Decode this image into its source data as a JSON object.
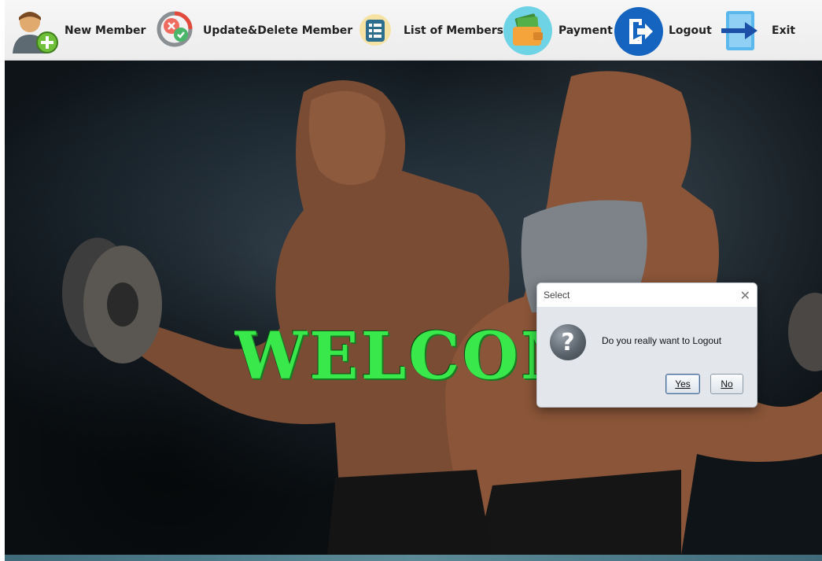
{
  "toolbar": {
    "items": [
      {
        "label": "New Member",
        "icon": "user-add-icon"
      },
      {
        "label": "Update&Delete Member",
        "icon": "update-delete-icon"
      },
      {
        "label": "List of Members",
        "icon": "list-icon"
      },
      {
        "label": "Payment",
        "icon": "wallet-icon"
      },
      {
        "label": "Logout",
        "icon": "logout-icon"
      },
      {
        "label": "Exit",
        "icon": "exit-arrow-icon"
      }
    ]
  },
  "main": {
    "welcome_text": "WELCOME"
  },
  "dialog": {
    "title": "Select",
    "close_glyph": "✕",
    "icon": "question-icon",
    "icon_glyph": "?",
    "message": "Do you really want to Logout",
    "yes_label": "Yes",
    "no_label": "No"
  },
  "colors": {
    "welcome_green": "#39e84a",
    "logout_blue": "#1565c0",
    "payment_teal": "#6fd3e6"
  }
}
